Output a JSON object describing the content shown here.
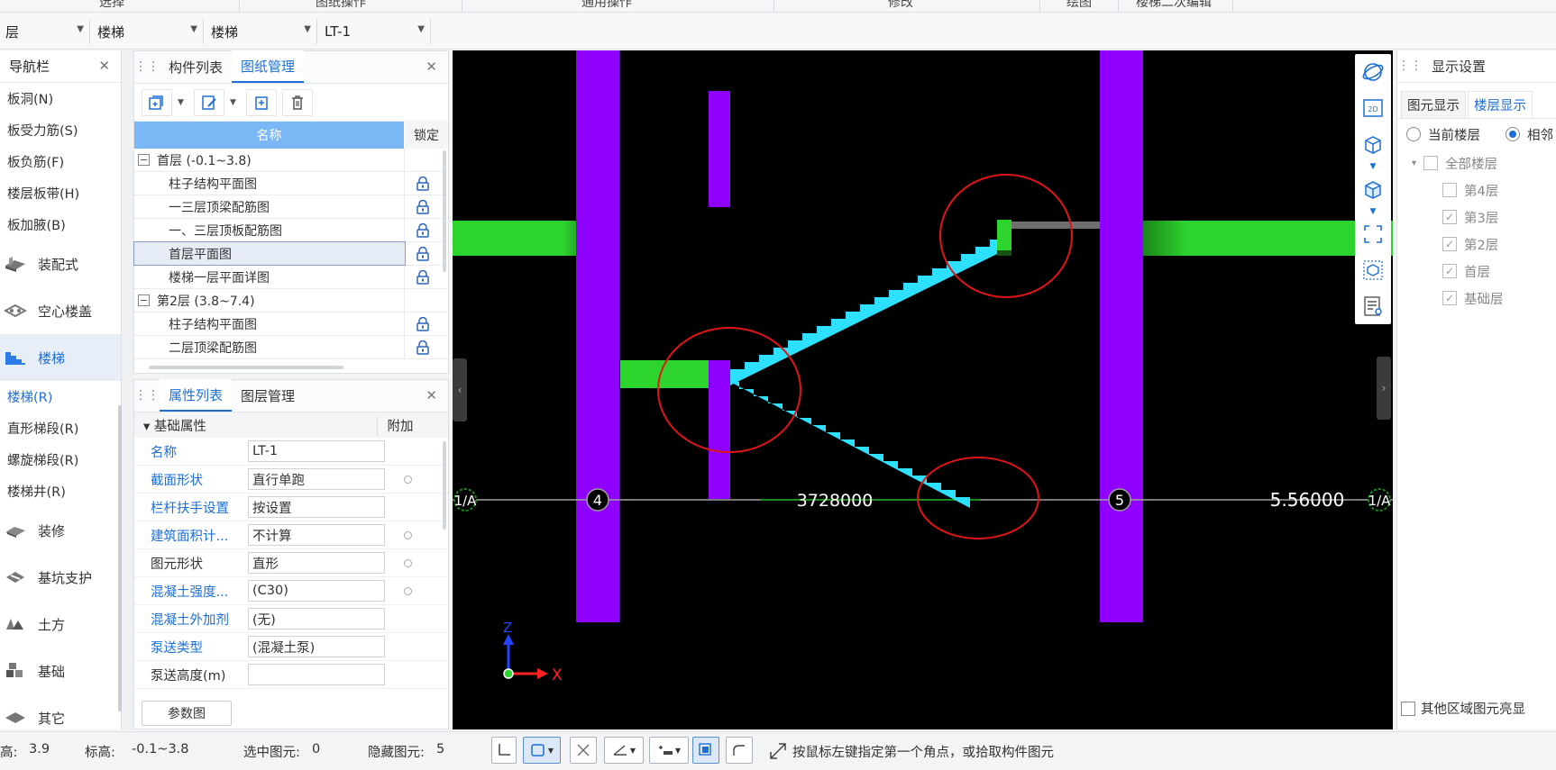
{
  "ribbon": {
    "groups": [
      "选择",
      "图纸操作",
      "通用操作",
      "修改",
      "绘图",
      "楼梯二次编辑"
    ]
  },
  "filter_bar": {
    "floor": "层",
    "category": "楼梯",
    "type": "楼梯",
    "component": "LT-1"
  },
  "nav": {
    "title": "导航栏",
    "top_items": [
      "板洞(N)",
      "板受力筋(S)",
      "板负筋(F)",
      "楼层板带(H)",
      "板加腋(B)"
    ],
    "categories_a": [
      "装配式",
      "空心楼盖",
      "楼梯"
    ],
    "stair_items": [
      "楼梯(R)",
      "直形梯段(R)",
      "螺旋梯段(R)",
      "楼梯井(R)"
    ],
    "categories_b": [
      "装修",
      "基坑支护",
      "土方",
      "基础",
      "其它"
    ]
  },
  "component_panel": {
    "tabs": [
      "构件列表",
      "图纸管理"
    ],
    "active_tab": "图纸管理",
    "col_name": "名称",
    "col_lock": "锁定",
    "rows": [
      {
        "type": "group",
        "label": "首层 (-0.1~3.8)"
      },
      {
        "type": "child",
        "label": "柱子结构平面图"
      },
      {
        "type": "child",
        "label": "一三层顶梁配筋图"
      },
      {
        "type": "child",
        "label": "一、三层顶板配筋图"
      },
      {
        "type": "child",
        "label": "首层平面图",
        "selected": true
      },
      {
        "type": "child",
        "label": "楼梯一层平面详图"
      },
      {
        "type": "group",
        "label": "第2层 (3.8~7.4)"
      },
      {
        "type": "child",
        "label": "柱子结构平面图"
      },
      {
        "type": "child",
        "label": "二层顶梁配筋图"
      }
    ]
  },
  "property_panel": {
    "tabs": [
      "属性列表",
      "图层管理"
    ],
    "section": "基础属性",
    "extra_col": "附加",
    "rows": [
      {
        "key": "名称",
        "value": "LT-1",
        "blue": true,
        "dot": false
      },
      {
        "key": "截面形状",
        "value": "直行单跑",
        "blue": true,
        "dot": true
      },
      {
        "key": "栏杆扶手设置",
        "value": "按设置",
        "blue": true,
        "dot": false
      },
      {
        "key": "建筑面积计...",
        "value": "不计算",
        "blue": true,
        "dot": true
      },
      {
        "key": "图元形状",
        "value": "直形",
        "blue": false,
        "dot": true
      },
      {
        "key": "混凝土强度...",
        "value": "(C30)",
        "blue": true,
        "dot": true
      },
      {
        "key": "混凝土外加剂",
        "value": "(无)",
        "blue": true,
        "dot": false
      },
      {
        "key": "泵送类型",
        "value": "(混凝土泵)",
        "blue": true,
        "dot": false
      },
      {
        "key": "泵送高度(m)",
        "value": "",
        "blue": false,
        "dot": false
      }
    ],
    "param_button": "参数图"
  },
  "canvas": {
    "axis_left": "4",
    "axis_right": "5",
    "dim_text": "3728000",
    "dim_right": "5.56000",
    "axis_edge": "1/A",
    "ucs_x": "X",
    "ucs_z": "Z",
    "colors": {
      "stair": "#2ee0ff",
      "column": "#8f00ff",
      "beam": "#2ed42e",
      "mark": "#e01515"
    }
  },
  "display_panel": {
    "title": "显示设置",
    "tabs": [
      "图元显示",
      "楼层显示"
    ],
    "active_tab": "楼层显示",
    "radio_current": "当前楼层",
    "radio_adjacent": "相邻",
    "tree_root": "全部楼层",
    "floors": [
      {
        "label": "第4层",
        "checked": false
      },
      {
        "label": "第3层",
        "checked": true
      },
      {
        "label": "第2层",
        "checked": true
      },
      {
        "label": "首层",
        "checked": true
      },
      {
        "label": "基础层",
        "checked": true
      }
    ],
    "other_area": "其他区域图元亮显"
  },
  "status": {
    "height_label": "高:",
    "height_value": "3.9",
    "elev_label": "标高:",
    "elev_value": "-0.1~3.8",
    "selected_label": "选中图元:",
    "selected_value": "0",
    "hidden_label": "隐藏图元:",
    "hidden_value": "5",
    "hint": "按鼠标左键指定第一个角点，或拾取构件图元"
  }
}
